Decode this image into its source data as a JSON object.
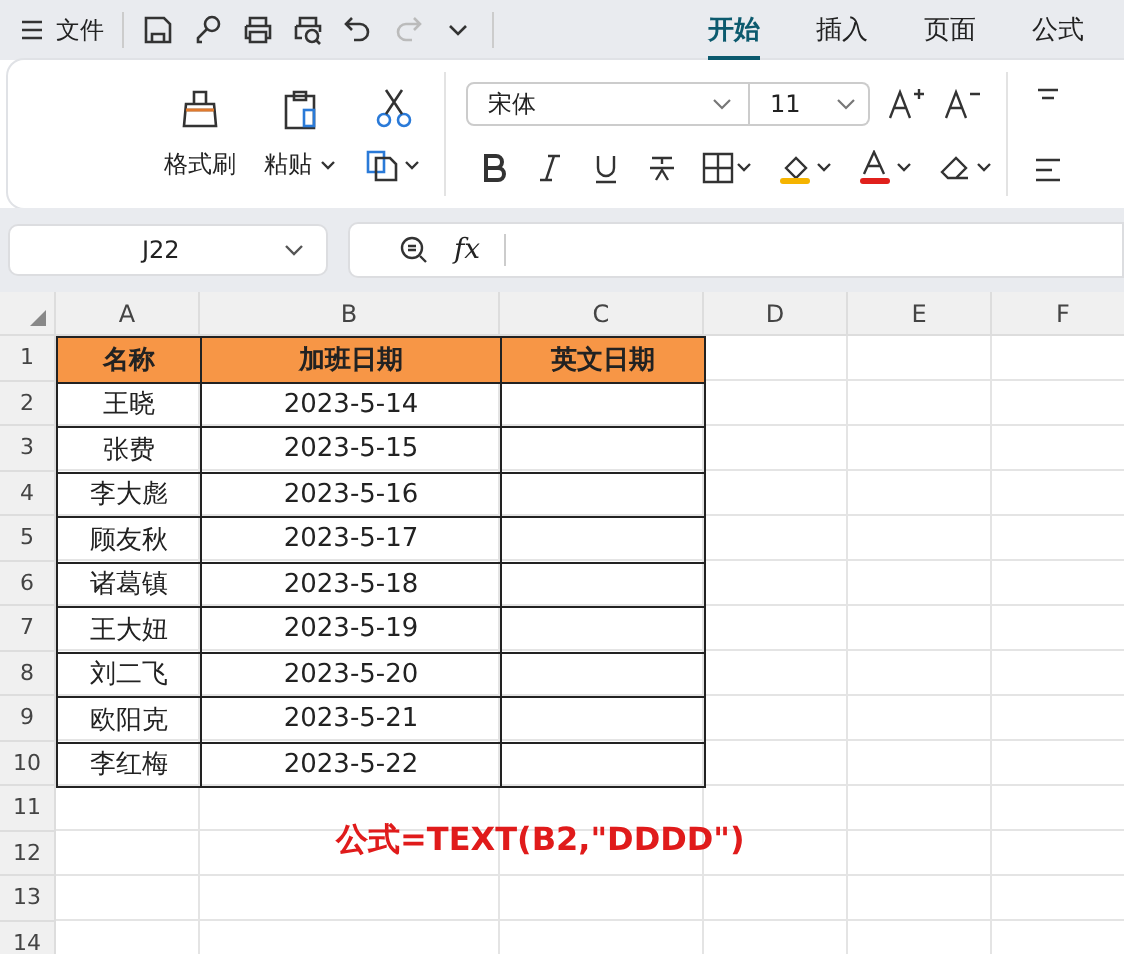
{
  "menu": {
    "label": "文件"
  },
  "tabs": [
    {
      "label": "开始",
      "selected": true
    },
    {
      "label": "插入",
      "selected": false
    },
    {
      "label": "页面",
      "selected": false
    },
    {
      "label": "公式",
      "selected": false
    }
  ],
  "ribbon": {
    "format_painter": "格式刷",
    "paste": "粘贴",
    "font": "宋体",
    "font_size": "11"
  },
  "name_box": "J22",
  "fx": "fx",
  "columns": [
    "A",
    "B",
    "C",
    "D",
    "E",
    "F"
  ],
  "rows": [
    {
      "num": "1",
      "kind": "header",
      "cells": [
        "名称",
        "加班日期",
        "英文日期"
      ]
    },
    {
      "num": "2",
      "kind": "data",
      "cells": [
        "王晓",
        "2023-5-14",
        ""
      ]
    },
    {
      "num": "3",
      "kind": "data",
      "cells": [
        "张费",
        "2023-5-15",
        ""
      ]
    },
    {
      "num": "4",
      "kind": "data",
      "cells": [
        "李大彪",
        "2023-5-16",
        ""
      ]
    },
    {
      "num": "5",
      "kind": "data",
      "cells": [
        "顾友秋",
        "2023-5-17",
        ""
      ]
    },
    {
      "num": "6",
      "kind": "data",
      "cells": [
        "诸葛镇",
        "2023-5-18",
        ""
      ]
    },
    {
      "num": "7",
      "kind": "data",
      "cells": [
        "王大妞",
        "2023-5-19",
        ""
      ]
    },
    {
      "num": "8",
      "kind": "data",
      "cells": [
        "刘二飞",
        "2023-5-20",
        ""
      ]
    },
    {
      "num": "9",
      "kind": "data",
      "cells": [
        "欧阳克",
        "2023-5-21",
        ""
      ]
    },
    {
      "num": "10",
      "kind": "data",
      "cells": [
        "李红梅",
        "2023-5-22",
        ""
      ]
    },
    {
      "num": "11",
      "cells": []
    },
    {
      "num": "12",
      "cells": []
    },
    {
      "num": "13",
      "cells": []
    },
    {
      "num": "14",
      "cells": []
    }
  ],
  "note": "公式=TEXT(B2,\"DDDD\")"
}
